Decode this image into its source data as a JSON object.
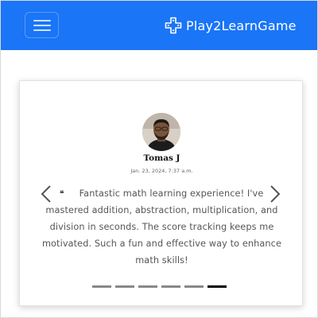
{
  "navbar": {
    "background_color": "#1a75f7",
    "menu_icon": "hamburger-icon",
    "brand": {
      "icon": "gamepad-cross-icon",
      "text": "Play2LearnGame"
    }
  },
  "testimonial": {
    "reviewer_name": "Tomas J",
    "date": "Jan. 23, 2024, 7:37 a.m.",
    "quote_icon": "quote-open-icon",
    "quote_mark": "❝",
    "review_lines": [
      "Fantastic math learning experience! I've",
      "mastered addition, abstraction, multiplication, and",
      "division in seconds. The score tracking keeps me",
      "motivated. Such a fun and effective way to enhance",
      "math skills!"
    ],
    "prev_icon": "chevron-left-icon",
    "next_icon": "chevron-right-icon",
    "slide_count": 6,
    "active_slide": 6
  }
}
